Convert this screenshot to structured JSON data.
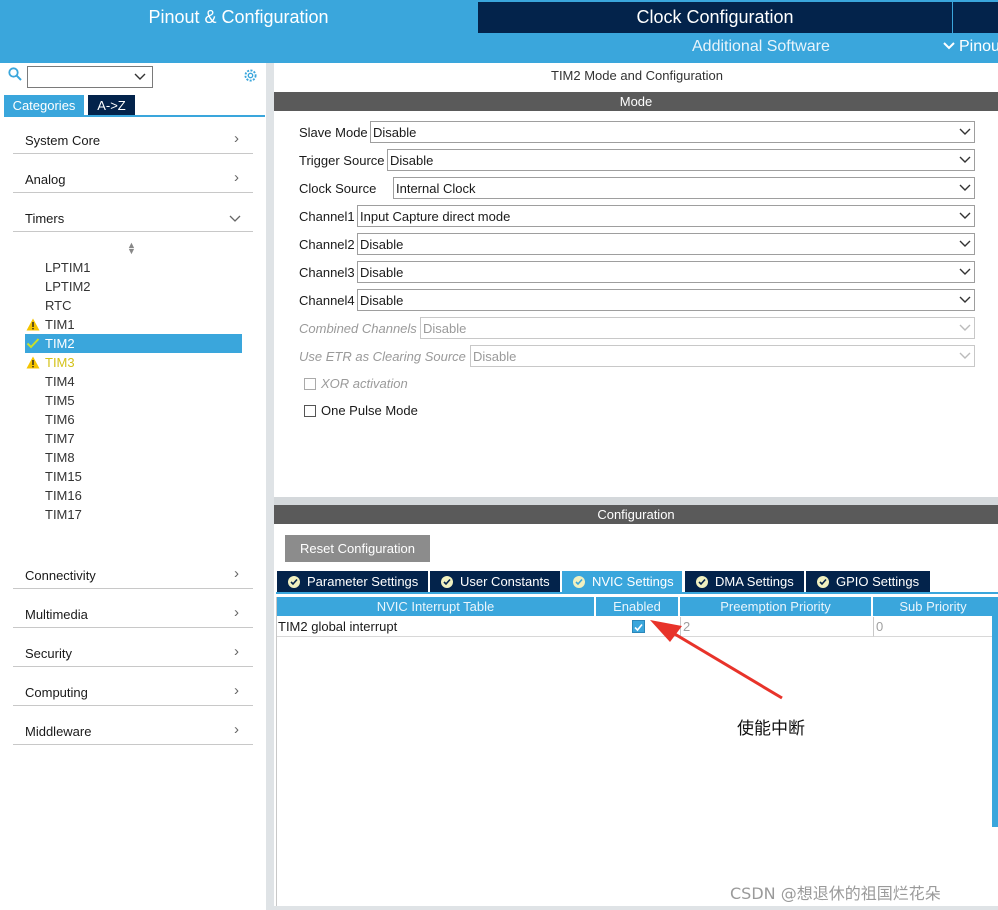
{
  "header": {
    "tab_pinout": "Pinout & Configuration",
    "tab_clock": "Clock Configuration",
    "sub_additional": "Additional Software",
    "sub_pinout": "Pinou"
  },
  "sidebar": {
    "search_value": "",
    "tabs": {
      "categories": "Categories",
      "az": "A->Z"
    },
    "categories_top": [
      {
        "label": "System Core"
      },
      {
        "label": "Analog"
      },
      {
        "label": "Timers"
      }
    ],
    "timers": [
      {
        "label": "LPTIM1",
        "status": "none"
      },
      {
        "label": "LPTIM2",
        "status": "none"
      },
      {
        "label": "RTC",
        "status": "none"
      },
      {
        "label": "TIM1",
        "status": "warning"
      },
      {
        "label": "TIM2",
        "status": "ok-selected"
      },
      {
        "label": "TIM3",
        "status": "warning-highlight"
      },
      {
        "label": "TIM4",
        "status": "none"
      },
      {
        "label": "TIM5",
        "status": "none"
      },
      {
        "label": "TIM6",
        "status": "none"
      },
      {
        "label": "TIM7",
        "status": "none"
      },
      {
        "label": "TIM8",
        "status": "none"
      },
      {
        "label": "TIM15",
        "status": "none"
      },
      {
        "label": "TIM16",
        "status": "none"
      },
      {
        "label": "TIM17",
        "status": "none"
      }
    ],
    "categories_bottom": [
      {
        "label": "Connectivity"
      },
      {
        "label": "Multimedia"
      },
      {
        "label": "Security"
      },
      {
        "label": "Computing"
      },
      {
        "label": "Middleware"
      }
    ]
  },
  "main": {
    "title": "TIM2 Mode and Configuration",
    "mode_header": "Mode",
    "fields": {
      "slave_mode": {
        "label": "Slave Mode",
        "value": "Disable"
      },
      "trigger_source": {
        "label": "Trigger Source",
        "value": "Disable"
      },
      "clock_source": {
        "label": "Clock Source",
        "value": "Internal Clock"
      },
      "channel1": {
        "label": "Channel1",
        "value": "Input Capture direct mode"
      },
      "channel2": {
        "label": "Channel2",
        "value": "Disable"
      },
      "channel3": {
        "label": "Channel3",
        "value": "Disable"
      },
      "channel4": {
        "label": "Channel4",
        "value": "Disable"
      },
      "combined_channels": {
        "label": "Combined Channels",
        "value": "Disable"
      },
      "use_etr": {
        "label": "Use ETR as Clearing Source",
        "value": "Disable"
      }
    },
    "checkboxes": {
      "xor": {
        "label": "XOR activation",
        "checked": false
      },
      "one_pulse": {
        "label": "One Pulse Mode",
        "checked": false
      }
    },
    "config_header": "Configuration",
    "reset_label": "Reset Configuration",
    "config_tabs": {
      "parameter": "Parameter Settings",
      "user_constants": "User Constants",
      "nvic": "NVIC Settings",
      "dma": "DMA Settings",
      "gpio": "GPIO Settings"
    },
    "nvic_table": {
      "columns": {
        "name": "NVIC Interrupt Table",
        "enabled": "Enabled",
        "preemption": "Preemption Priority",
        "sub": "Sub Priority"
      },
      "row": {
        "name": "TIM2 global interrupt",
        "enabled": true,
        "preemption": "2",
        "sub": "0"
      }
    }
  },
  "annotation": "使能中断",
  "watermark": "CSDN @想退休的祖国烂花朵",
  "colors": {
    "accent": "#3aa6dc",
    "navy": "#03234b",
    "bar_dark": "#5a5a5a",
    "warning": "#f5c400",
    "arrow": "#e8332a"
  }
}
